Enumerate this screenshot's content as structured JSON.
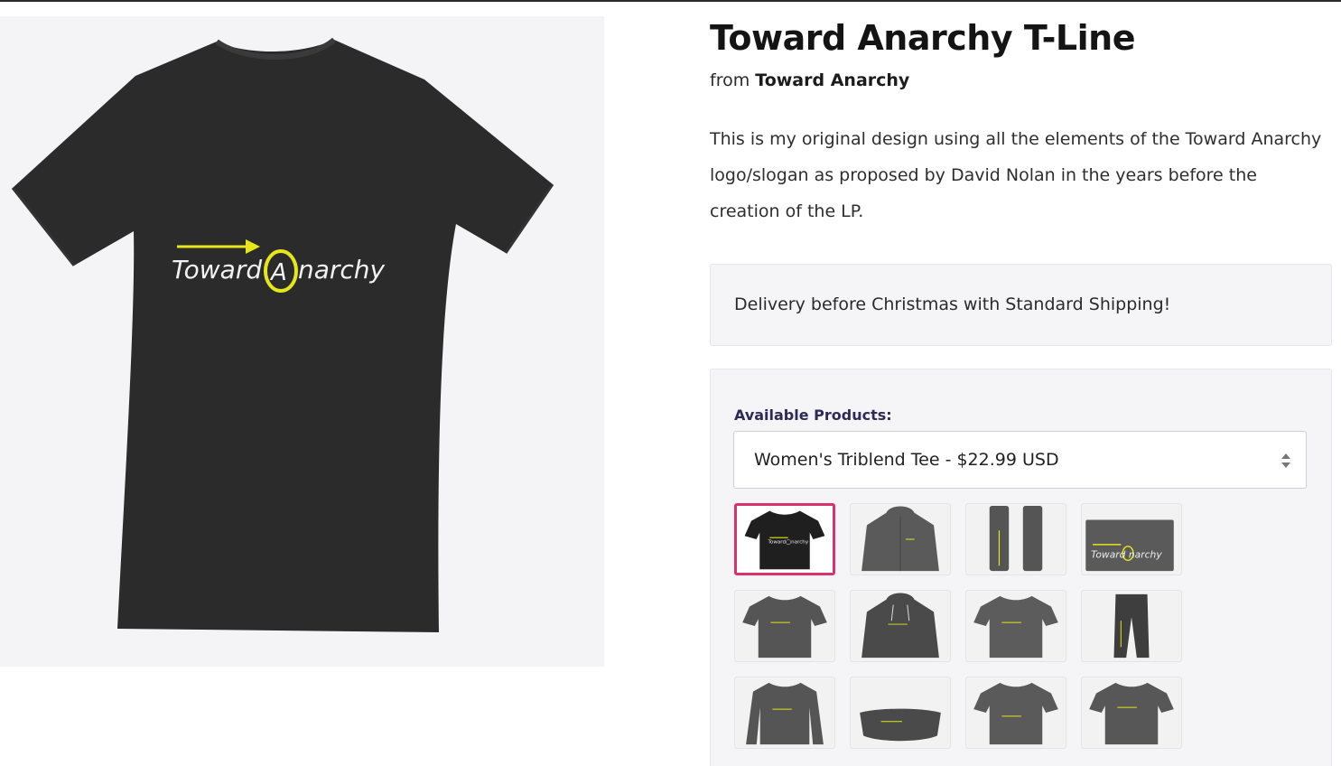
{
  "product": {
    "title": "Toward Anarchy T-Line",
    "from_label": "from",
    "store_name": "Toward Anarchy",
    "description": "This is my original design using all the elements of the Toward Anarchy logo/slogan as proposed by David Nolan in the years before the creation of the LP.",
    "design_text_left": "Toward",
    "design_text_circle": "A",
    "design_text_right": "narchy"
  },
  "notice": {
    "delivery": "Delivery before Christmas with Standard Shipping!"
  },
  "products": {
    "label": "Available Products:",
    "selected": "Women's Triblend Tee - $22.99 USD",
    "thumbnails": [
      {
        "name": "womens-triblend-tee",
        "icon": "tshirt-icon",
        "selected": true
      },
      {
        "name": "zip-hoodie",
        "icon": "hoodie-icon",
        "selected": false
      },
      {
        "name": "socks",
        "icon": "socks-icon",
        "selected": false
      },
      {
        "name": "pouch",
        "icon": "pouch-icon",
        "selected": false
      },
      {
        "name": "classic-tee",
        "icon": "tshirt-icon",
        "selected": false
      },
      {
        "name": "pullover-hoodie",
        "icon": "hoodie-icon",
        "selected": false
      },
      {
        "name": "premium-tee",
        "icon": "tshirt-icon",
        "selected": false
      },
      {
        "name": "joggers",
        "icon": "pants-icon",
        "selected": false
      },
      {
        "name": "long-sleeve-tee",
        "icon": "longsleeve-icon",
        "selected": false
      },
      {
        "name": "fanny-pack",
        "icon": "fannypack-icon",
        "selected": false
      },
      {
        "name": "womens-tee",
        "icon": "tshirt-icon",
        "selected": false
      },
      {
        "name": "unisex-tee",
        "icon": "tshirt-icon",
        "selected": false
      }
    ]
  },
  "colors": {
    "accent_selected": "#d6336c",
    "logo_yellow": "#e6e61a",
    "shirt_dark": "#2b2b2b",
    "thumb_gray": "#555555"
  }
}
